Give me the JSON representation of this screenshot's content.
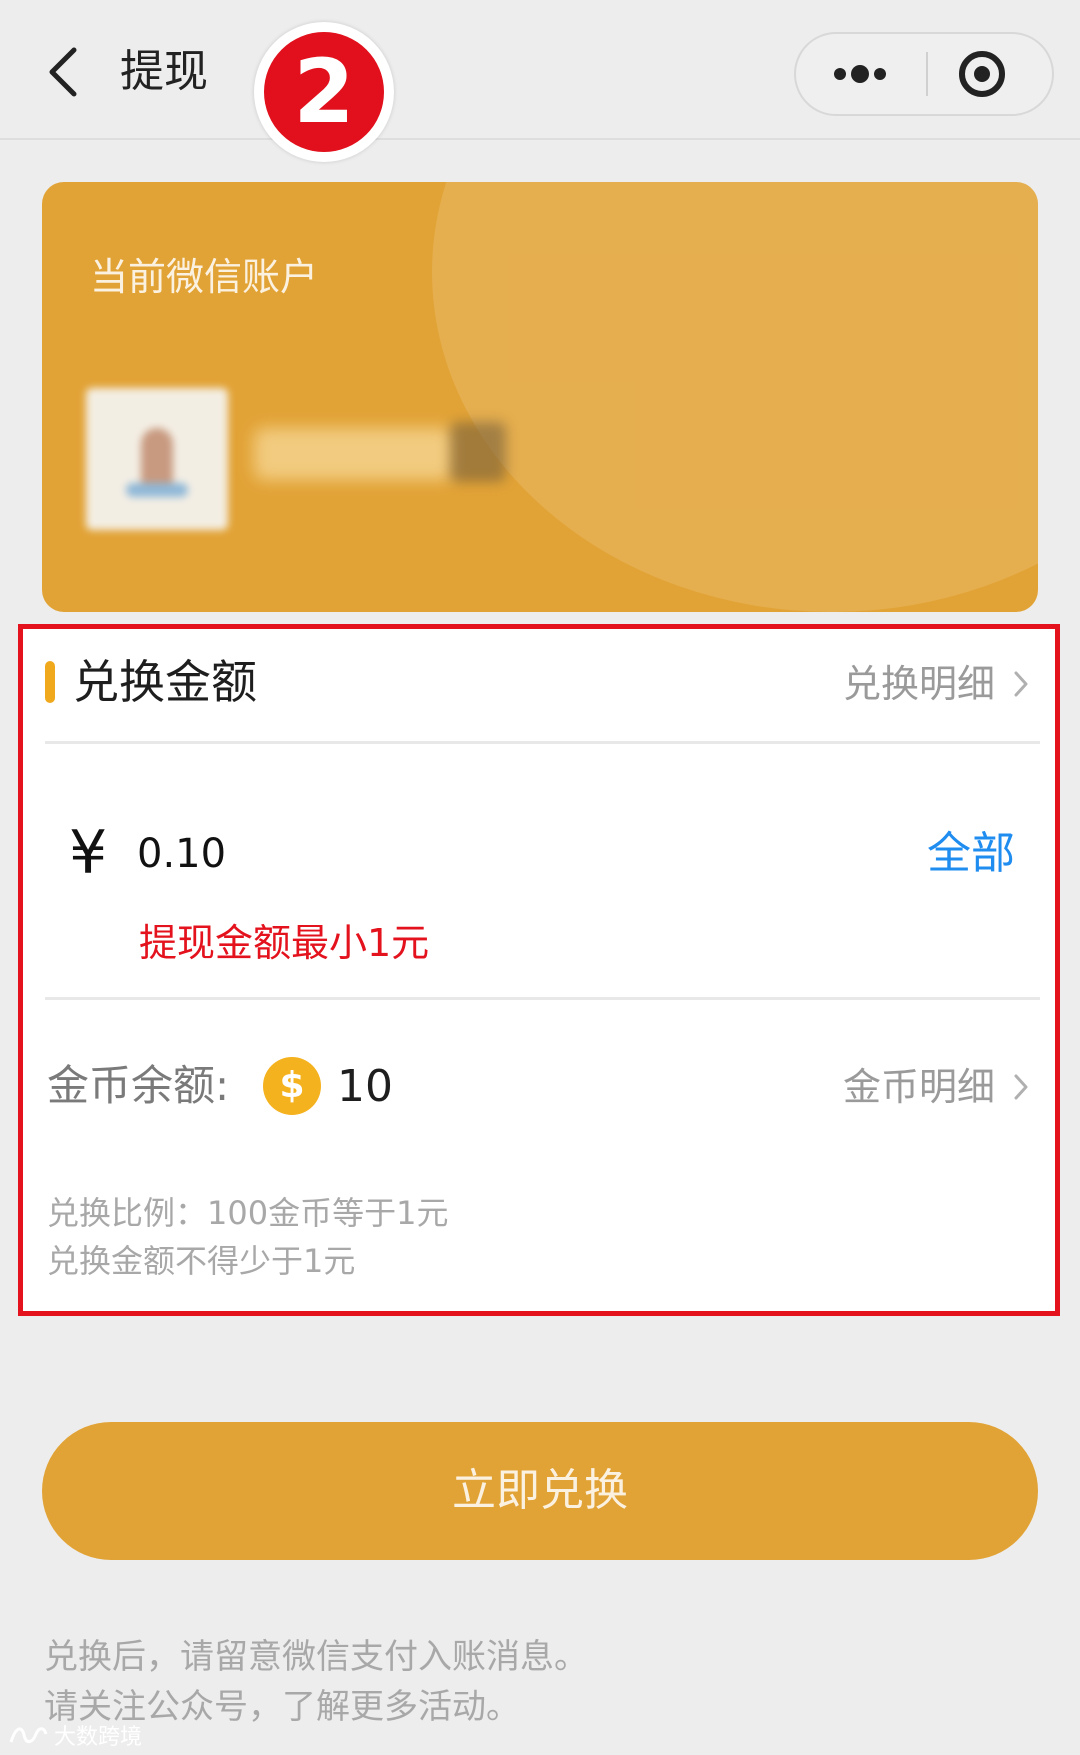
{
  "nav": {
    "title": "提现",
    "step_number": "2"
  },
  "account_card": {
    "label": "当前微信账户"
  },
  "exchange": {
    "section_title": "兑换金额",
    "detail_link": "兑换明细",
    "currency_symbol": "¥",
    "amount_value": "0.10",
    "all_button": "全部",
    "error_message": "提现金额最小1元",
    "balance_label": "金币余额:",
    "coin_symbol": "$",
    "balance_value": "10",
    "coin_detail_link": "金币明细",
    "notes": [
      "兑换比例：100金币等于1元",
      "兑换金额不得少于1元"
    ]
  },
  "actions": {
    "redeem_button": "立即兑换"
  },
  "footer": {
    "notes": [
      "兑换后，请留意微信支付入账消息。",
      "请关注公众号，了解更多活动。"
    ],
    "watermark": "大数跨境"
  },
  "colors": {
    "brand_orange": "#e2a336",
    "highlight_border": "#e3121d",
    "link_blue": "#1f8cf0",
    "coin": "#f5b21f"
  },
  "icons": {
    "back": "back-arrow-icon",
    "more": "more-dots-icon",
    "close": "target-close-icon",
    "chevron": "chevron-right-icon",
    "coin": "coin-icon"
  }
}
